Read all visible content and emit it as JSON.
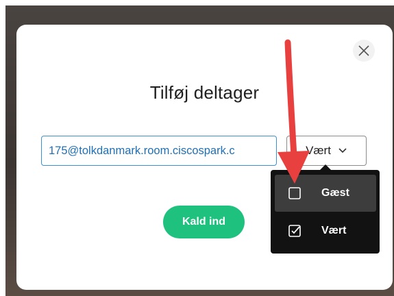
{
  "dialog": {
    "title": "Tilføj deltager",
    "email_value": "175@tolkdanmark.room.ciscospark.c",
    "role_selected": "Vært",
    "call_button": "Kald ind"
  },
  "role_menu": {
    "options": [
      {
        "label": "Gæst",
        "checked": false
      },
      {
        "label": "Vært",
        "checked": true
      }
    ]
  },
  "colors": {
    "accent_green": "#1ec27e",
    "input_border": "#3d8fd1",
    "menu_bg": "#121212",
    "annotation_arrow": "#e8403f"
  },
  "icons": {
    "close": "close-icon",
    "chevron": "chevron-down-icon",
    "unchecked": "checkbox-unchecked-icon",
    "checked": "checkbox-checked-icon"
  }
}
